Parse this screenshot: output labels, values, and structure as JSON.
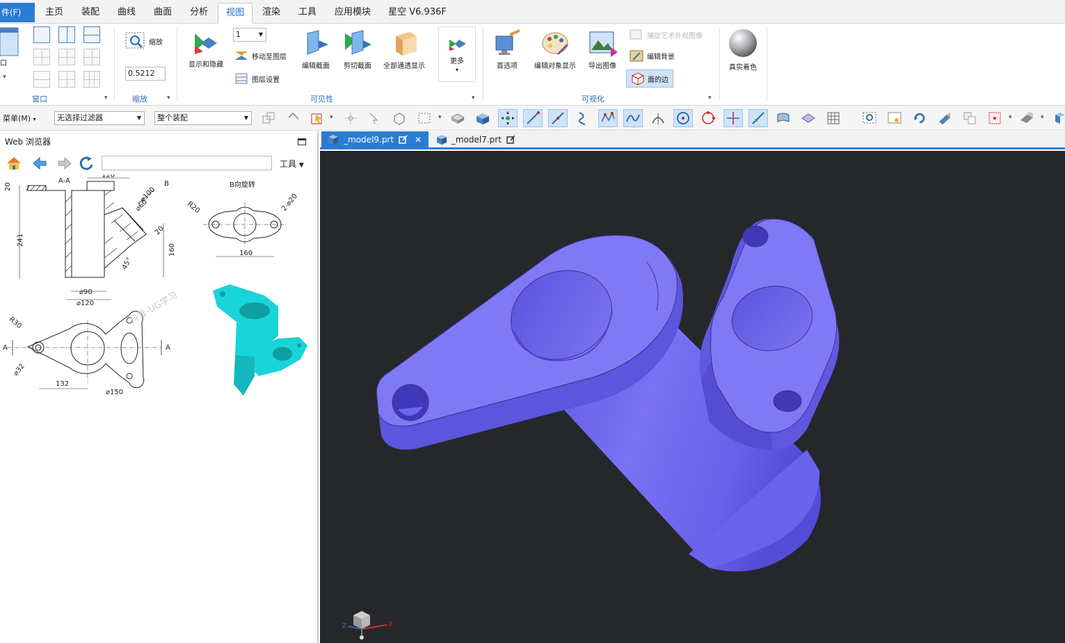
{
  "menubar": {
    "file": "件(F)",
    "tabs": [
      "主页",
      "装配",
      "曲线",
      "曲面",
      "分析",
      "视图",
      "渲染",
      "工具",
      "应用模块",
      "星空 V6.936F"
    ],
    "active_tab": "视图"
  },
  "ribbon": {
    "window_group": {
      "label": "窗口",
      "big_button": "口"
    },
    "zoom_group": {
      "label": "缩放",
      "zoom_button": "缩放",
      "zoom_value": "0.5212"
    },
    "visibility_group": {
      "label": "可见性",
      "layer_value": "1",
      "show_hide": "显示和隐藏",
      "move_to_layer": "移动至图层",
      "layer_settings": "图层设置",
      "edit_section": "编辑截面",
      "clip_section": "剪切截面",
      "all_transparent": "全部通透显示",
      "more": "更多"
    },
    "visualization_group": {
      "label": "可视化",
      "preferences": "首选项",
      "edit_object_display": "编辑对象显示",
      "export_image": "导出图像",
      "capture_art": "捕捉艺术外观图像",
      "edit_background": "编辑背景",
      "face_edges": "面的边"
    },
    "true_shading": "真实着色"
  },
  "toolbar": {
    "menu": "菜单(M)",
    "selection_filter": "无选择过滤器",
    "scope": "整个装配"
  },
  "web_panel": {
    "title": "Web 浏览器",
    "tools_label": "工具",
    "url": ""
  },
  "drawing": {
    "section_label": "A-A",
    "b_label": "B",
    "rotate_label": "B向旋转",
    "dims": {
      "d20_top": "20",
      "d120_top": "120",
      "d241": "241",
      "d100": "⌀100",
      "d60": "⌀60",
      "d20_side": "20",
      "d160_v": "160",
      "d45": "45°",
      "d90": "⌀90",
      "d120_bot": "⌀120",
      "r20": "R20",
      "holes": "2-⌀20",
      "d160_h": "160",
      "r30": "R30",
      "d32": "⌀32",
      "d132": "132",
      "d150": "⌀150",
      "a_left": "A",
      "a_right": "A"
    },
    "watermark": "抖音-UG学习"
  },
  "doc_tabs": [
    {
      "name": "_model9.prt",
      "active": true
    },
    {
      "name": "_model7.prt",
      "active": false
    }
  ],
  "colors": {
    "accent": "#2b7cd3",
    "model_face": "#7b74f4",
    "viewport_bg": "#26272b",
    "preview_model": "#19d4d8"
  },
  "triad": {
    "x": "X",
    "z": "Z"
  }
}
